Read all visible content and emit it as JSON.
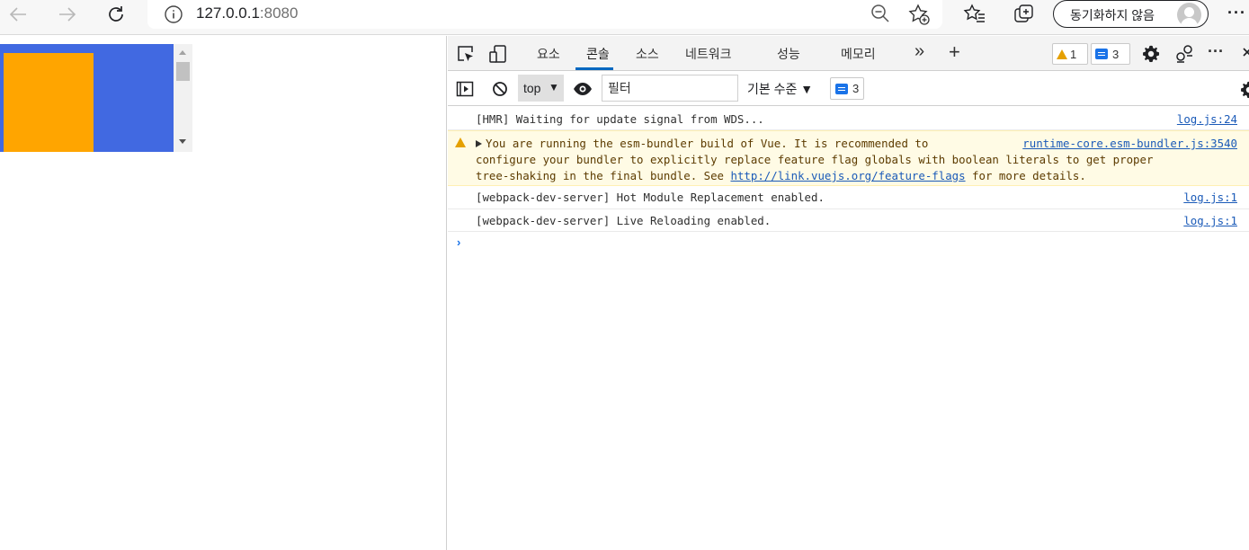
{
  "browser": {
    "url_host": "127.0.0.1",
    "url_port": ":8080",
    "sync_label": "동기화하지 않음",
    "more_label": "···"
  },
  "page": {
    "box_color": "#4169e1",
    "inner_box_color": "#ffa500"
  },
  "devtools": {
    "tabs": [
      {
        "label": "요소"
      },
      {
        "label": "콘솔"
      },
      {
        "label": "소스"
      },
      {
        "label": "네트워크"
      },
      {
        "label": "성능"
      },
      {
        "label": "메모리"
      }
    ],
    "active_tab": "콘솔",
    "more_tabs_label": "»",
    "add_tab_label": "+",
    "warning_count": "1",
    "message_count": "3",
    "more_menu_label": "···",
    "toolbar": {
      "context": "top",
      "filter_placeholder": "필터",
      "levels_label": "기본 수준 ▼",
      "issues_count": "3"
    },
    "console": [
      {
        "type": "log",
        "text": "[HMR] Waiting for update signal from WDS...",
        "source": "log.js:24"
      },
      {
        "type": "warning",
        "line1": "You are running the esm-bundler build of Vue. It is recommended to",
        "line2": "configure your bundler to explicitly replace feature flag globals with boolean literals to get proper",
        "line3_before": "tree-shaking in the final bundle. See ",
        "link": "http://link.vuejs.org/feature-flags",
        "line3_after": " for more details.",
        "source": "runtime-core.esm-bundler.js:3540"
      },
      {
        "type": "log",
        "text": "[webpack-dev-server] Hot Module Replacement enabled.",
        "source": "log.js:1"
      },
      {
        "type": "log",
        "text": "[webpack-dev-server] Live Reloading enabled.",
        "source": "log.js:1"
      }
    ]
  }
}
